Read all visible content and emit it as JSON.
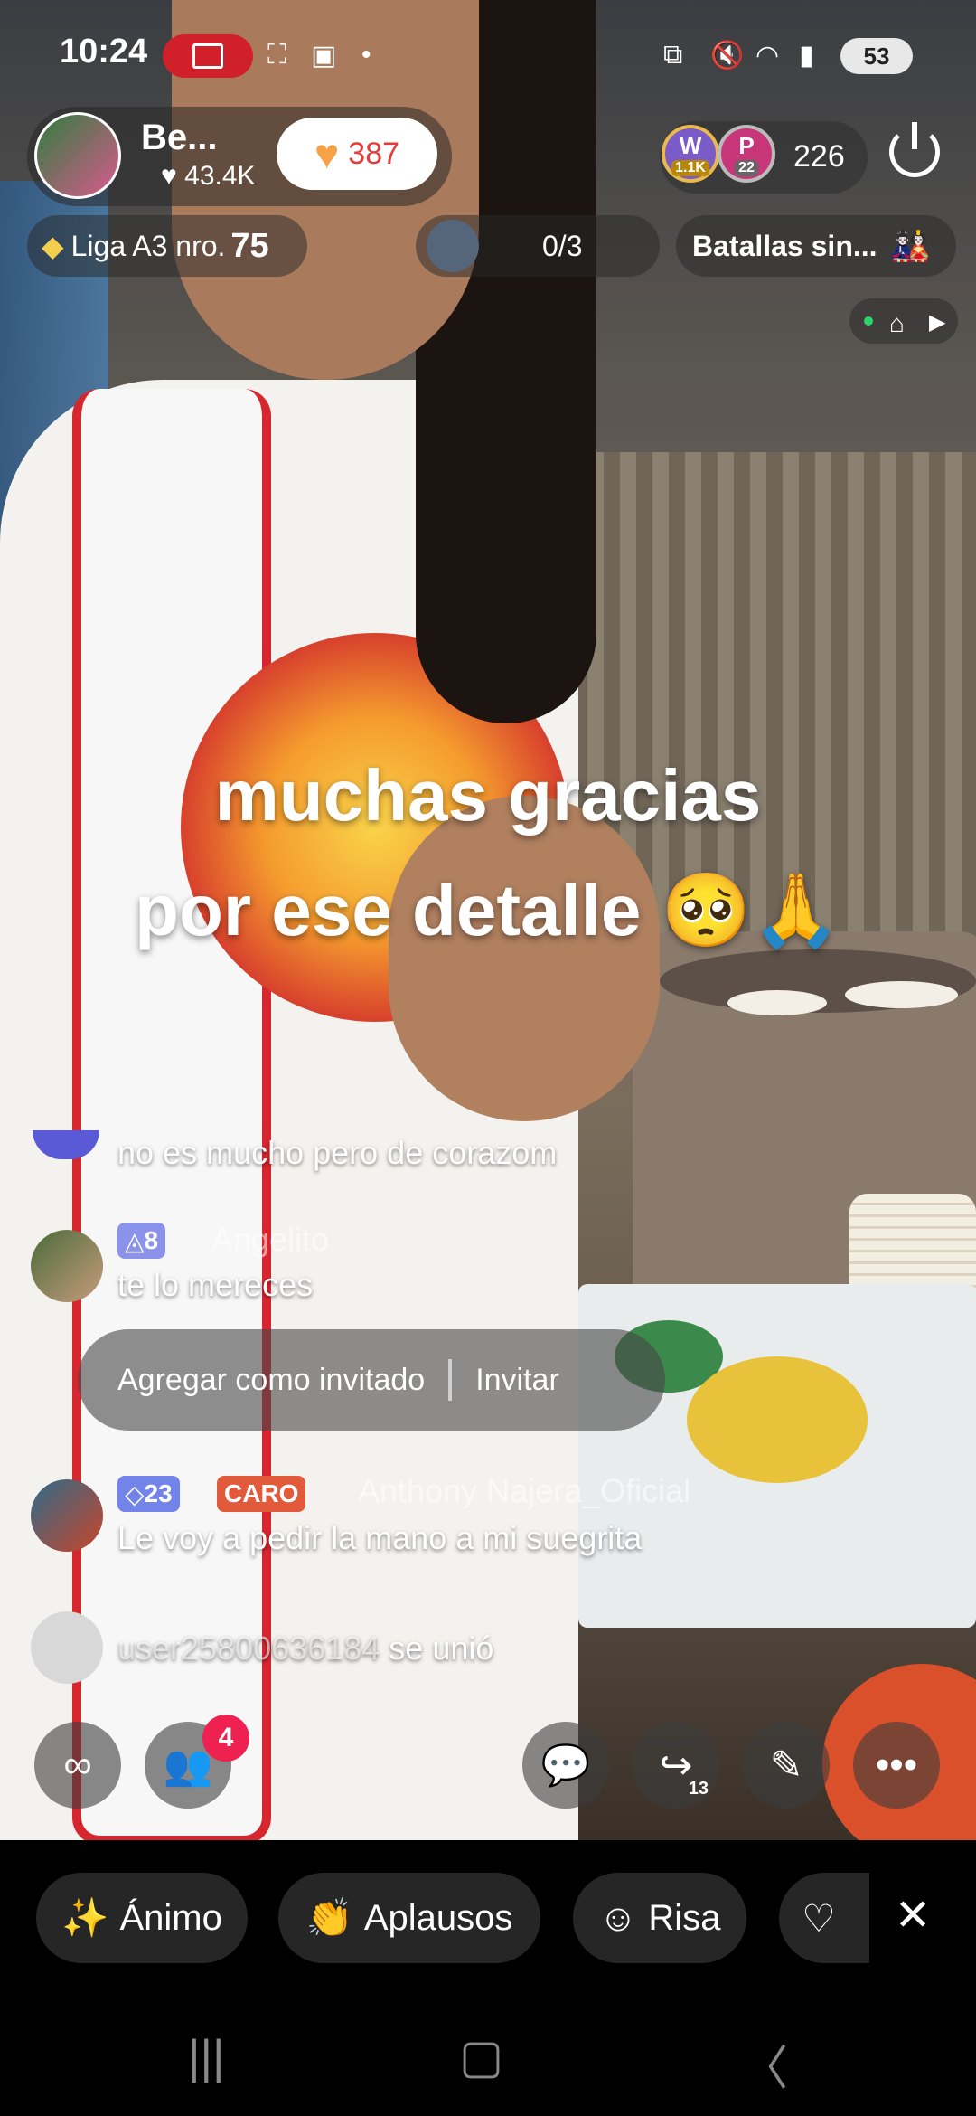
{
  "status_bar": {
    "time": "10:24",
    "battery": "53"
  },
  "host": {
    "name": "Be...",
    "likes": "43.4K",
    "follow_count": "387"
  },
  "viewers": {
    "badge_1_letter": "W",
    "badge_1_value": "1.1K",
    "badge_2_letter": "P",
    "badge_2_value": "22",
    "count": "226"
  },
  "league": {
    "label": "Liga A3 nro.",
    "rank": "75"
  },
  "goals": {
    "progress": "0/3"
  },
  "battles": {
    "label": "Batallas sin..."
  },
  "caption": {
    "line1": "muchas gracias",
    "line2": "por ese detalle 🥺🙏"
  },
  "chat": {
    "messages": [
      {
        "text": "no es mucho pero de corazom"
      },
      {
        "level": "8",
        "name": "Angelito",
        "text": "te lo mereces"
      },
      {
        "level": "23",
        "tag": "CARO",
        "name": "Anthony Najera_Oficial",
        "text": "Le voy a pedir la mano a mi suegrita"
      }
    ],
    "join": {
      "user": "user25800636184",
      "action": "se unió"
    }
  },
  "context_menu": {
    "add_guest": "Agregar como invitado",
    "invite": "Invitar"
  },
  "toolbar": {
    "guests_notification": "4",
    "share_count": "13"
  },
  "reactions": [
    {
      "label": "Ánimo"
    },
    {
      "label": "Aplausos"
    },
    {
      "label": "Risa"
    }
  ]
}
